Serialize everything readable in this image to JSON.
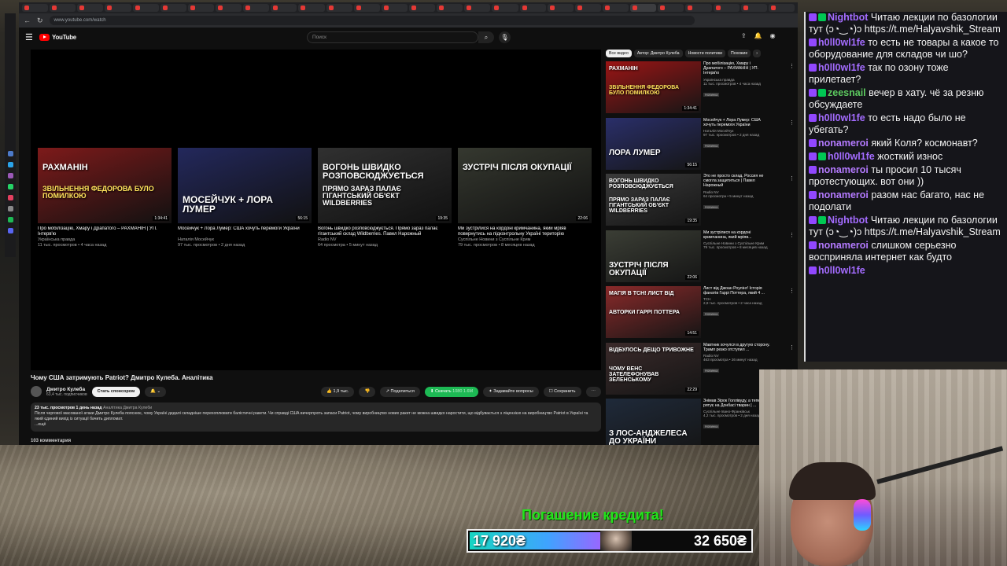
{
  "browser": {
    "url": "www.youtube.com/watch"
  },
  "youtube": {
    "logo_text": "YouTube",
    "search_placeholder": "Поиск",
    "video": {
      "title": "Чому США затримують Patriot? Дмитро Кулеба. Аналітика",
      "channel": "Дмитро Кулеба",
      "subscribers": "63,4 тыс. подписчиков",
      "sponsor_label": "Стать спонсором",
      "likes": "1,9 тыс.",
      "share_label": "Поделиться",
      "download_label": "Скачать",
      "download_extra": "1080 1.6M",
      "ask_label": "Задавайте вопросы",
      "save_label": "Сохранить",
      "desc_stats": "23 тыс. просмотров  1 день назад",
      "desc_tags": "Аналітика Дмитра Кулеби",
      "desc_text": "Після чергової масованої атаки Дмитро Кулеба пояснює, чому Україні дедалі складніше перехоплювати балістичні ракети. Чи справді США вичерпують запаси Patriot, чому виробництво нових ракет не можна швидко наростити, що відбувається з ліцензією на виробництво Patriot в Україні та який єдиний вихід із ситуації бачить дипломат.",
      "desc_more": "...ещё",
      "comments": "103 комментария"
    },
    "endcards": [
      {
        "title": "Про мобілізацію, Хмару і Драпатого – РАХМАНІН | УП. Інтерв'ю",
        "channel": "Українська правда",
        "meta": "11 тыс. просмотров • 4 часа назад",
        "duration": "1:34:41",
        "thumb_text": "РАХМАНІН",
        "thumb_sub": "ЗВІЛЬНЕННЯ ФЕДОРОВА БУЛО ПОМИЛКОЮ"
      },
      {
        "title": "Мосейчук + Лора Лумер: США хочуть перемоги України",
        "channel": "Наталія Мосейчук",
        "meta": "97 тыс. просмотров • 2 дня назад",
        "duration": "56:15",
        "thumb_text": "МОСЕЙЧУК + ЛОРА ЛУМЕР",
        "thumb_sub": ""
      },
      {
        "title": "Вогонь швидко розповсюджується. Прямо зараз палає гігантський склад Wildberries. Павел Нарожный",
        "channel": "Radio NV",
        "meta": "64 просмотра • 5 минут назад",
        "duration": "19:35",
        "thumb_text": "ВОГОНЬ ШВИДКО РОЗПОВСЮДЖУЄТЬСЯ",
        "thumb_sub": "ПРЯМО ЗАРАЗ ПАЛАЄ ГІГАНТСЬКИЙ ОБ'ЄКТ WILDBERRIES"
      },
      {
        "title": "Ми зустрілися на кордоні кримчанина, який мріяв повернутись на підконтрольну Україні територію",
        "channel": "Суспільне Новини з Суспільне Крим",
        "meta": "79 тыс. просмотров • 8 месяцев назад",
        "duration": "22:06",
        "thumb_text": "ЗУСТРІЧ ПІСЛЯ ОКУПАЦІЇ",
        "thumb_sub": ""
      }
    ],
    "chips": [
      "Все видео",
      "Автор: Дмитро Кулеба",
      "Новости политики",
      "Похожие"
    ],
    "recommendations": [
      {
        "title": "Про мобілізацію, Хмару і Драпатого – РАХМАНІН | УП. Інтерв'ю",
        "channel": "Українська правда",
        "meta": "11 тыс. просмотров • 4 часа назад",
        "badge": "Новинка",
        "duration": "1:34:41",
        "thumb_text": "РАХМАНІН",
        "thumb_sub": "ЗВІЛЬНЕННЯ ФЕДОРОВА БУЛО ПОМИЛКОЮ",
        "color": "#9b1515"
      },
      {
        "title": "Мосейчук + Лора Лумер: США хочуть перемоги України",
        "channel": "Наталія Мосейчук",
        "meta": "97 тыс. просмотров • 2 дня назад",
        "badge": "Новинка",
        "duration": "56:15",
        "thumb_text": "ЛОРА ЛУМЕР",
        "thumb_sub": "",
        "color": "#2a2f6a"
      },
      {
        "title": "Это не просто склад. Россия не смогла защититься | Павел Нарожный",
        "channel": "Radio NV",
        "meta": "64 просмотра • 5 минут назад",
        "badge": "Новинка",
        "duration": "19:35",
        "thumb_text": "ВОГОНЬ ШВИДКО РОЗПОВСЮДЖУЄТЬСЯ",
        "thumb_sub": "ПРЯМО ЗАРАЗ ПАЛАЄ ГІГАНТСЬКИЙ ОБ'ЄКТ WILDBERRIES",
        "color": "#3a3a3a"
      },
      {
        "title": "Ми зустрілися на кордоні кримчанина, який мріяв...",
        "channel": "Суспільне Новини з Суспільне Крим",
        "meta": "79 тыс. просмотров • 8 месяцев назад",
        "badge": "",
        "duration": "22:06",
        "thumb_text": "ЗУСТРІЧ ПІСЛЯ ОКУПАЦІЇ",
        "thumb_sub": "",
        "color": "#3b3e35"
      },
      {
        "title": "Лист від Джоан Роулінг! Історія фанатів Гаррі Поттера, який 4 ...",
        "channel": "ТСН",
        "meta": "2,8 тыс. просмотров • 2 часа назад",
        "badge": "Новинка",
        "duration": "14:51",
        "thumb_text": "МАГІЯ В ТСН! ЛИСТ ВІД",
        "thumb_sub": "АВТОРКИ ГАРРІ ПОТТЕРА",
        "color": "#8a2a2a"
      },
      {
        "title": "Мавтник хочулся в другую сторону. Трамп резко отступил ...",
        "channel": "Radio NV",
        "meta": "463 просмотра • 26 минут назад",
        "badge": "Новинка",
        "duration": "22:29",
        "thumb_text": "ВІДБУЛОСЬ ДЕЩО ТРИВОЖНЕ",
        "thumb_sub": "ЧОМУ ВЕНС ЗАТЕЛЕФОНУВАВ ЗЕЛЕНСЬКОМУ",
        "color": "#3a2a2a"
      },
      {
        "title": "Знімав Зірок Голлівуду, а тепер рятує на Донбасі тварин | ...",
        "channel": "Суспільне Івано-Франківськ",
        "meta": "4,2 тыс. просмотров • 2 дня назад",
        "badge": "Новинка",
        "duration": "",
        "thumb_text": "З ЛОС-АНДЖЕЛЕСА ДО УКРАЇНИ",
        "thumb_sub": "",
        "color": "#1f2a3a"
      }
    ]
  },
  "chat": {
    "messages": [
      {
        "nick": "Nightbot",
        "text": "Читаю лекции по базологии тут (ɔ◔‿◔)ɔ https://t.me/Halyavshik_Stream",
        "nick_color": "#a46cff"
      },
      {
        "nick": "h0ll0wl1fe",
        "text": "то есть не товары а какое то оборудование для складов чи шо?",
        "nick_color": "#a46cff"
      },
      {
        "nick": "h0ll0wl1fe",
        "text": "так по озону тоже прилетает?",
        "nick_color": "#a46cff"
      },
      {
        "nick": "zeesnail",
        "text": "вечер в хату. чё за резню обсуждаете",
        "nick_color": "#5cc95f"
      },
      {
        "nick": "h0ll0wl1fe",
        "text": "то есть надо было не убегать?",
        "nick_color": "#a46cff"
      },
      {
        "nick": "nonameroi",
        "text": "який Коля? космонавт?",
        "nick_color": "#b47aff"
      },
      {
        "nick": "h0ll0wl1fe",
        "text": "жосткий износ",
        "nick_color": "#a46cff"
      },
      {
        "nick": "nonameroi",
        "text": "ты просил 10 тысяч протестующих. вот они ))",
        "nick_color": "#b47aff"
      },
      {
        "nick": "nonameroi",
        "text": "разом нас багато, нас не подолати",
        "nick_color": "#b47aff"
      },
      {
        "nick": "Nightbot",
        "text": "Читаю лекции по базологии тут (ɔ◔‿◔)ɔ https://t.me/Halyavshik_Stream",
        "nick_color": "#a46cff"
      },
      {
        "nick": "nonameroi",
        "text": "слишком серьезно восприняла интернет как будто",
        "nick_color": "#b47aff"
      },
      {
        "nick": "h0ll0wl1fe",
        "text": "",
        "nick_color": "#a46cff"
      }
    ]
  },
  "donation": {
    "title": "Погашение кредита!",
    "current": "17 920₴",
    "goal": "32 650₴",
    "progress": 0.55
  }
}
